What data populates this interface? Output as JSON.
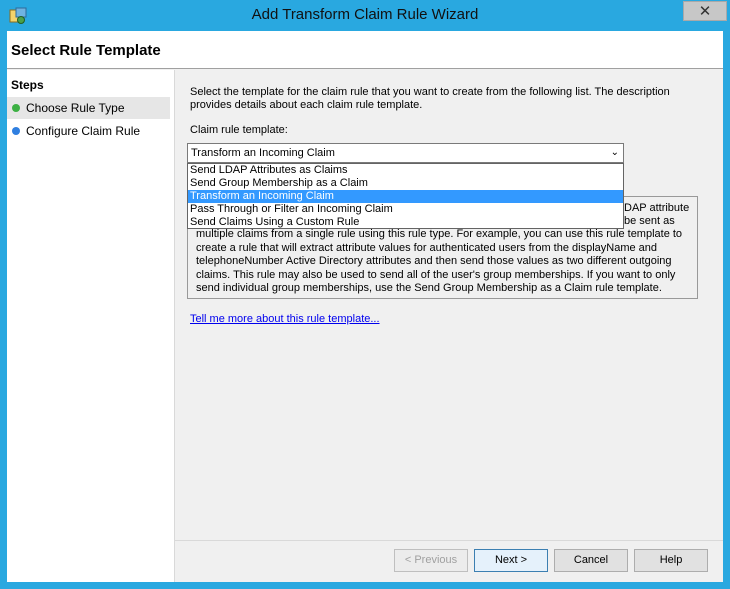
{
  "window": {
    "title": "Add Transform Claim Rule Wizard",
    "close_glyph": "✕"
  },
  "header": {
    "title": "Select Rule Template"
  },
  "steps": {
    "title": "Steps",
    "items": [
      {
        "label": "Choose Rule Type",
        "color": "#3cb043",
        "active": true
      },
      {
        "label": "Configure Claim Rule",
        "color": "#2f7fe0",
        "active": false
      }
    ]
  },
  "main": {
    "description": "Select the template for the claim rule that you want to create from the following list. The description provides details about each claim rule template.",
    "template_label": "Claim rule template:",
    "selected_template": "Transform an Incoming Claim",
    "options": [
      "Send LDAP Attributes as Claims",
      "Send Group Membership as a Claim",
      "Transform an Incoming Claim",
      "Pass Through or Filter an Incoming Claim",
      "Send Claims Using a Custom Rule"
    ],
    "selected_index": 2,
    "template_description_partial": [
      "DAP attribute",
      "be sent as",
      "multiple claims from a single rule using this rule type. For example, you can use this rule template to create a rule that will extract attribute values for authenticated users from the displayName and telephoneNumber Active Directory attributes and then send those values as two different outgoing claims. This rule may also be used to send all of the user's group memberships. If you want to only send individual group memberships, use the Send Group Membership as a Claim rule template."
    ],
    "help_link": "Tell me more about this rule template..."
  },
  "buttons": {
    "previous": "< Previous",
    "next": "Next >",
    "cancel": "Cancel",
    "help": "Help"
  }
}
